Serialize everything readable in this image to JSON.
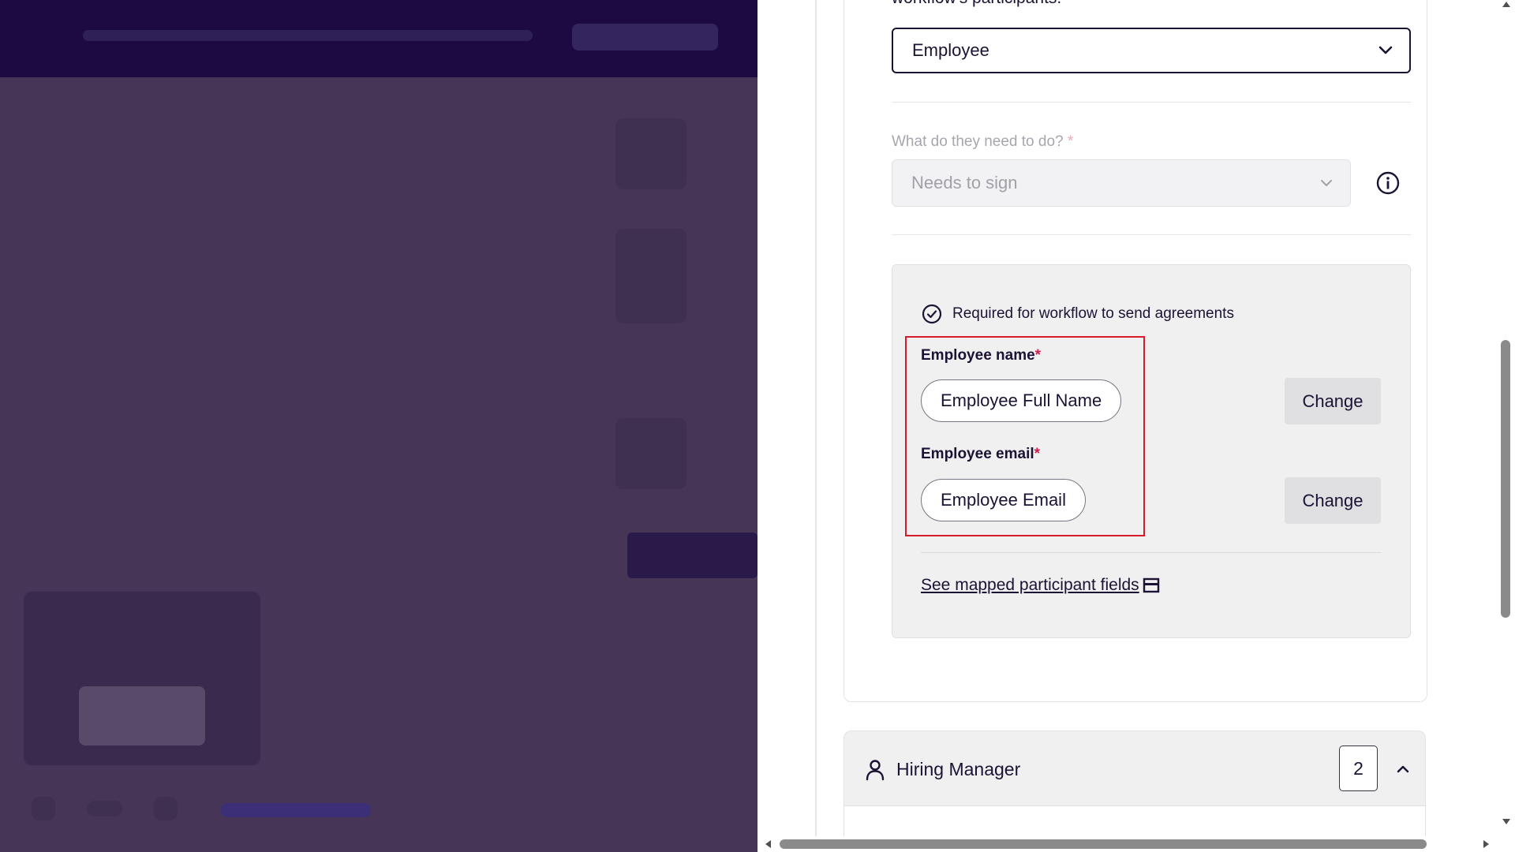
{
  "participant": {
    "cut_label": "workflow's participants.",
    "role_select": {
      "value": "Employee"
    },
    "action": {
      "label": "What do they need to do?",
      "required_mark": "*",
      "select_value": "Needs to sign",
      "info_icon": "info-circle-icon"
    },
    "required_box": {
      "notice": "Required for workflow to send agreements",
      "notice_icon": "check-circle-icon",
      "fields": [
        {
          "label": "Employee name",
          "required_mark": "*",
          "value": "Employee Full Name",
          "change_label": "Change"
        },
        {
          "label": "Employee email",
          "required_mark": "*",
          "value": "Employee Email",
          "change_label": "Change"
        }
      ],
      "mapped_link": "See mapped participant fields",
      "mapped_icon": "panel-icon"
    }
  },
  "next_section": {
    "icon": "person-icon",
    "title": "Hiring Manager",
    "badge": "2",
    "toggle_icon": "chevron-up-icon"
  },
  "colors": {
    "primary_text": "#1c1233",
    "required_red": "#d21c49",
    "highlight_red": "#d81b2a",
    "overlay": "#463557",
    "topbar": "#1d0a42"
  }
}
